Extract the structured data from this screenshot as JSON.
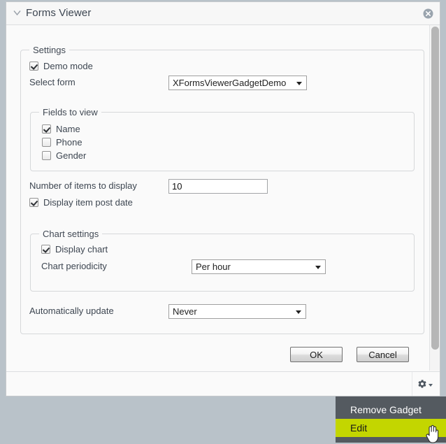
{
  "window": {
    "title": "Forms Viewer",
    "collapse_icon": "chevron-down-icon",
    "close_icon": "close-circle-icon"
  },
  "settings": {
    "legend": "Settings",
    "demo_mode": {
      "label": "Demo mode",
      "checked": true
    },
    "select_form": {
      "label": "Select form",
      "value": "XFormsViewerGadgetDemo"
    },
    "fields_to_view": {
      "legend": "Fields to view",
      "items": [
        {
          "label": "Name",
          "checked": true
        },
        {
          "label": "Phone",
          "checked": false
        },
        {
          "label": "Gender",
          "checked": false
        }
      ]
    },
    "number_of_items": {
      "label": "Number of items to display",
      "value": "10"
    },
    "display_post_date": {
      "label": "Display item post date",
      "checked": true
    },
    "chart_settings": {
      "legend": "Chart settings",
      "display_chart": {
        "label": "Display chart",
        "checked": true
      },
      "periodicity": {
        "label": "Chart periodicity",
        "value": "Per hour"
      }
    },
    "auto_update": {
      "label": "Automatically update",
      "value": "Never"
    }
  },
  "buttons": {
    "ok": "OK",
    "cancel": "Cancel"
  },
  "footer": {
    "gear_icon": "gear-icon",
    "caret_icon": "caret-down-icon"
  },
  "context_menu": {
    "items": [
      {
        "label": "Remove Gadget",
        "highlighted": false
      },
      {
        "label": "Edit",
        "highlighted": true
      }
    ]
  },
  "colors": {
    "page_background": "#b9c2c9",
    "panel_background": "#fafafa",
    "menu_background": "#545a60",
    "menu_highlight": "#c3d600",
    "text": "#3b4450"
  }
}
